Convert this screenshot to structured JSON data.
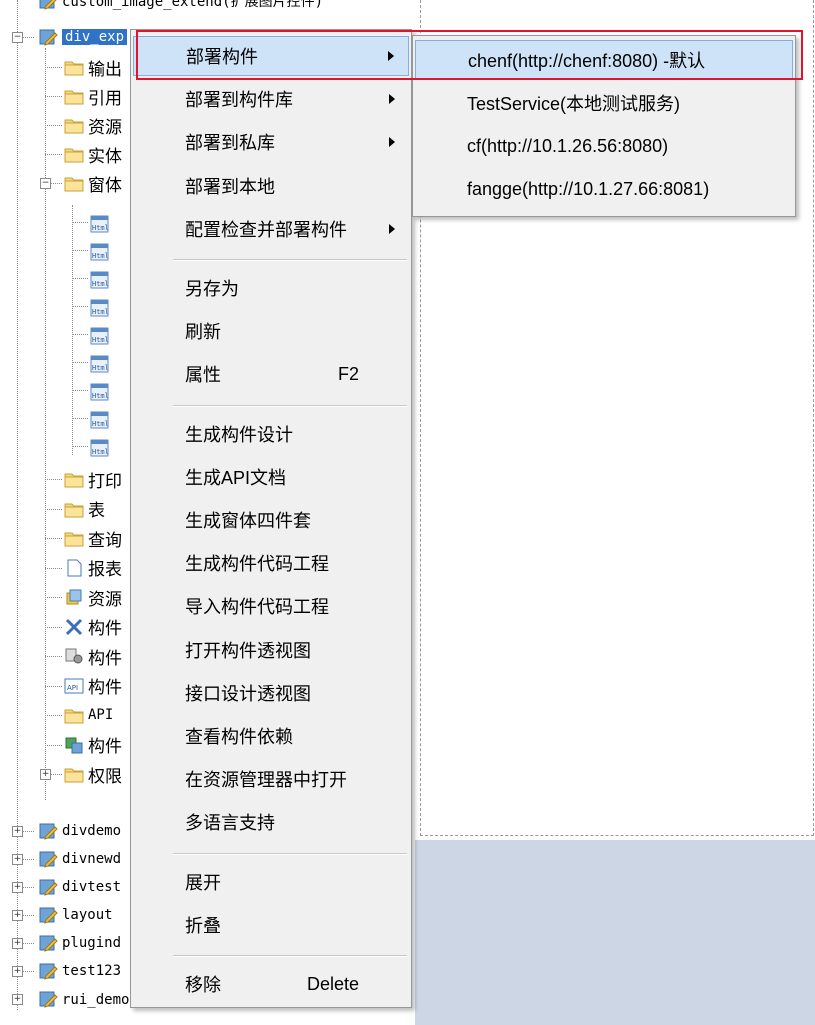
{
  "tree": {
    "top_clipped": "custom_image_extend(扩展图片控件)",
    "selected_project": "div_exp",
    "children": [
      {
        "label": "输出",
        "icon": "folder-icon"
      },
      {
        "label": "引用",
        "icon": "folder-icon"
      },
      {
        "label": "资源",
        "icon": "folder-icon"
      },
      {
        "label": "实体",
        "icon": "folder-icon"
      },
      {
        "label": "窗体",
        "icon": "folder-icon"
      }
    ],
    "html_files": [
      "Html",
      "Html",
      "Html",
      "Html",
      "Html",
      "Html",
      "Html",
      "Html",
      "Html"
    ],
    "lower_children": [
      {
        "label": "打印",
        "icon": "folder-icon"
      },
      {
        "label": "表",
        "icon": "folder-icon"
      },
      {
        "label": "查询",
        "icon": "folder-icon"
      },
      {
        "label": "报表",
        "icon": "document-icon"
      },
      {
        "label": "资源",
        "icon": "resource-icon"
      },
      {
        "label": "构件",
        "icon": "component-x-icon"
      },
      {
        "label": "构件",
        "icon": "component-gear-icon"
      },
      {
        "label": "构件",
        "icon": "api-icon"
      },
      {
        "label": "API",
        "icon": "folder-icon"
      },
      {
        "label": "构件",
        "icon": "component-link-icon"
      },
      {
        "label": "权限",
        "icon": "folder-icon"
      }
    ],
    "projects": [
      "divdemo",
      "divnewd",
      "divtest",
      "layout",
      "plugind",
      "test123"
    ],
    "bottom_clipped": "rui_demo(rui样例)"
  },
  "context_menu": {
    "items": [
      {
        "label": "部署构件",
        "submenu": true,
        "highlighted": true
      },
      {
        "label": "部署到构件库",
        "submenu": true
      },
      {
        "label": "部署到私库",
        "submenu": true
      },
      {
        "label": "部署到本地"
      },
      {
        "label": "配置检查并部署构件",
        "submenu": true
      },
      {
        "separator": true
      },
      {
        "label": "另存为"
      },
      {
        "label": "刷新"
      },
      {
        "label": "属性",
        "shortcut": "F2"
      },
      {
        "separator": true
      },
      {
        "label": "生成构件设计"
      },
      {
        "label": "生成API文档"
      },
      {
        "label": "生成窗体四件套"
      },
      {
        "label": "生成构件代码工程"
      },
      {
        "label": "导入构件代码工程"
      },
      {
        "label": "打开构件透视图"
      },
      {
        "label": "接口设计透视图"
      },
      {
        "label": "查看构件依赖"
      },
      {
        "label": "在资源管理器中打开"
      },
      {
        "label": "多语言支持"
      },
      {
        "separator": true
      },
      {
        "label": "展开"
      },
      {
        "label": "折叠"
      },
      {
        "separator": true
      },
      {
        "label": "移除",
        "shortcut": "Delete"
      }
    ]
  },
  "submenu": {
    "items": [
      {
        "label": "chenf(http://chenf:8080) -默认",
        "highlighted": true
      },
      {
        "label": "TestService(本地测试服务)"
      },
      {
        "label": "cf(http://10.1.26.56:8080)"
      },
      {
        "label": "fangge(http://10.1.27.66:8081)"
      }
    ]
  },
  "colors": {
    "selection": "#3072c6",
    "menu_highlight": "#cfe3f8",
    "annotation_red": "#e0142c",
    "surface_gray": "#ccd6e4"
  }
}
